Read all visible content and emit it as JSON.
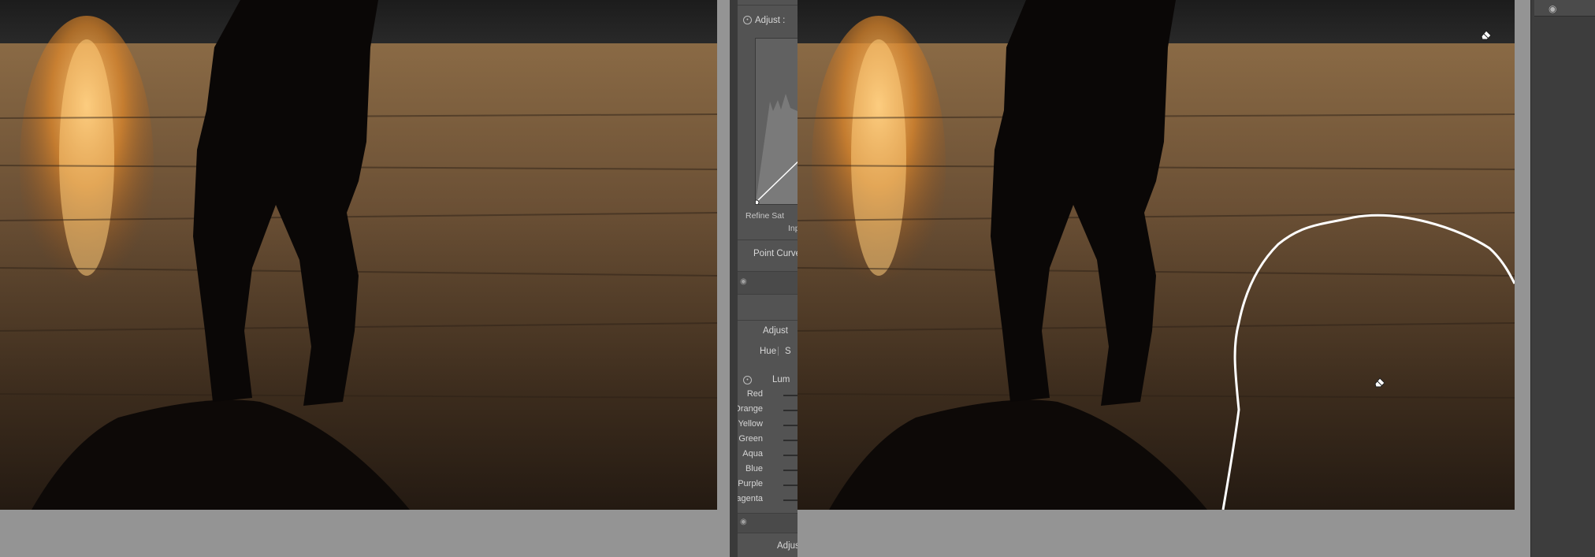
{
  "panel": {
    "adjust_label": "Adjust :",
    "refine_label": "Refine Sat",
    "input_label": "Inp",
    "point_curve_label": "Point Curve",
    "adjust_label2": "Adjust",
    "hue_label": "Hue",
    "hue_sep": "|",
    "hue_next": "S",
    "luminance_label": "Lum",
    "hsl_rows": [
      "Red",
      "Orange",
      "Yellow",
      "Green",
      "Aqua",
      "Blue",
      "Purple",
      "Magenta"
    ],
    "adjust_label3": "Adjus"
  },
  "icons": {
    "eye": "eye-icon",
    "eraser": "eraser-icon",
    "target": "target-adjust-icon"
  }
}
